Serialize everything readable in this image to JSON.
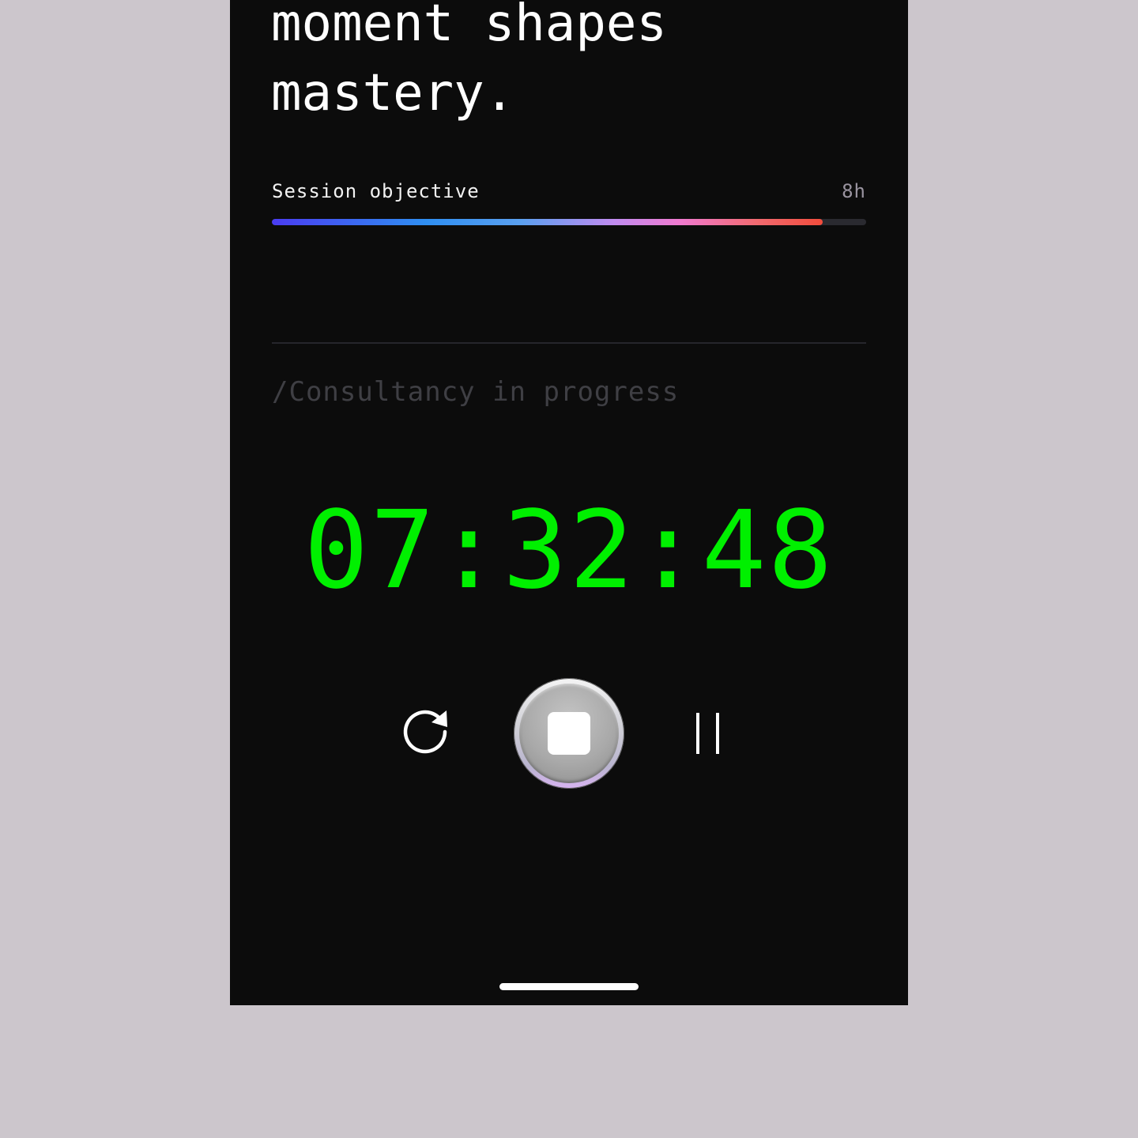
{
  "headline": {
    "lines": [
      "moment shapes",
      "mastery."
    ]
  },
  "objective": {
    "label": "Session objective",
    "target": "8h",
    "progress_fraction": 0.927
  },
  "status": {
    "text": "/Consultancy in progress"
  },
  "timer": {
    "elapsed": "07:32:48",
    "color": "#00f000"
  },
  "controls": {
    "reset_icon": "reset-icon",
    "stop_icon": "stop-icon",
    "pause_icon": "pause-icon"
  },
  "colors": {
    "background": "#0c0c0c",
    "page": "#ccc6cc",
    "gradient": [
      "#4a3cf2",
      "#2f8ff2",
      "#c08cf0",
      "#f07ad0",
      "#f24c3c"
    ]
  }
}
